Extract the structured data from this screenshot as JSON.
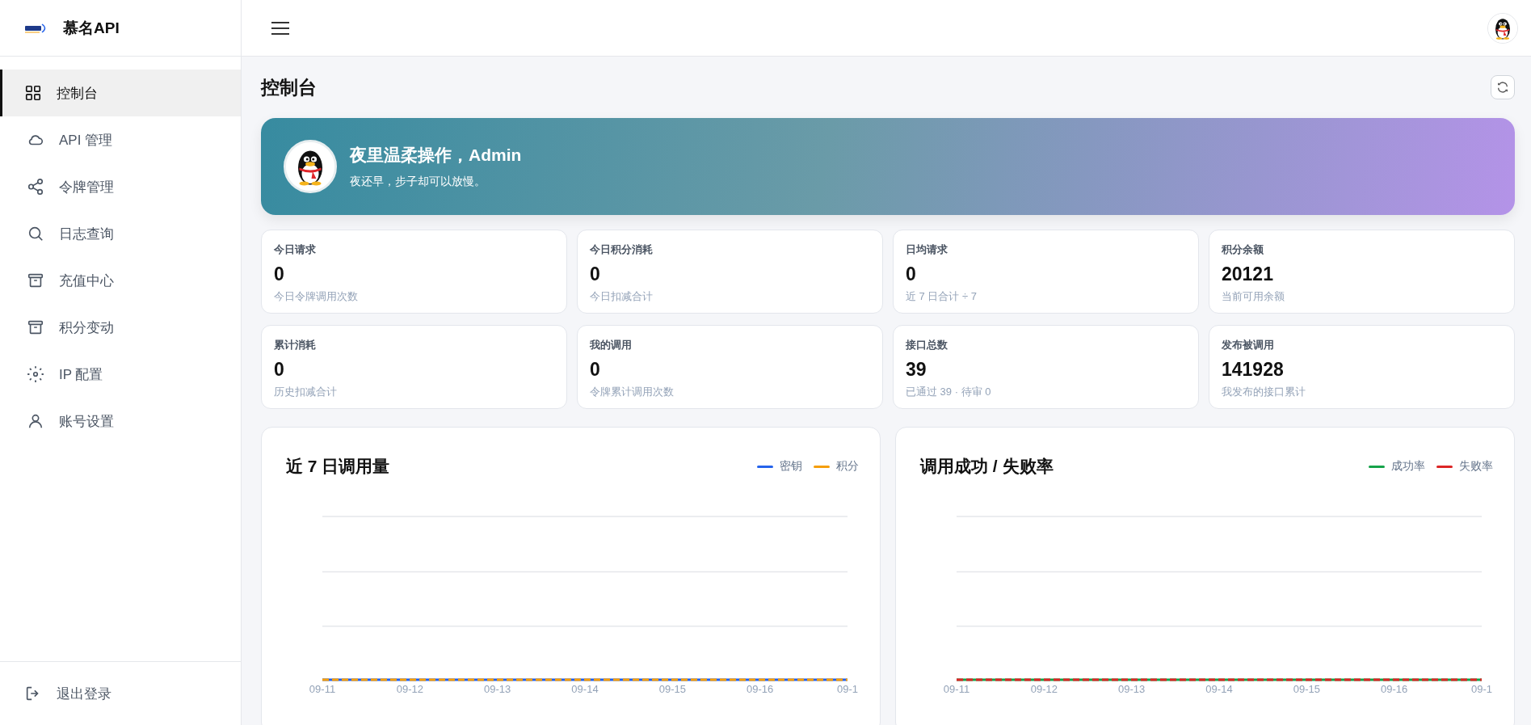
{
  "brand": {
    "name": "慕名API"
  },
  "sidebar": {
    "items": [
      {
        "label": "控制台",
        "selected": true
      },
      {
        "label": "API 管理",
        "selected": false
      },
      {
        "label": "令牌管理",
        "selected": false
      },
      {
        "label": "日志查询",
        "selected": false
      },
      {
        "label": "充值中心",
        "selected": false
      },
      {
        "label": "积分变动",
        "selected": false
      },
      {
        "label": "IP 配置",
        "selected": false
      },
      {
        "label": "账号设置",
        "selected": false
      }
    ],
    "logout": "退出登录"
  },
  "page": {
    "title": "控制台"
  },
  "banner": {
    "greeting": "夜里温柔操作，Admin",
    "subtitle": "夜还早，步子却可以放慢。"
  },
  "stats": [
    {
      "label": "今日请求",
      "value": "0",
      "note": "今日令牌调用次数"
    },
    {
      "label": "今日积分消耗",
      "value": "0",
      "note": "今日扣减合计"
    },
    {
      "label": "日均请求",
      "value": "0",
      "note": "近 7 日合计 ÷ 7"
    },
    {
      "label": "积分余额",
      "value": "20121",
      "note": "当前可用余额"
    },
    {
      "label": "累计消耗",
      "value": "0",
      "note": "历史扣减合计"
    },
    {
      "label": "我的调用",
      "value": "0",
      "note": "令牌累计调用次数"
    },
    {
      "label": "接口总数",
      "value": "39",
      "note": "已通过 39 · 待审 0"
    },
    {
      "label": "发布被调用",
      "value": "141928",
      "note": "我发布的接口累计"
    }
  ],
  "charts": [
    {
      "title": "近 7 日调用量",
      "legend": [
        {
          "label": "密钥",
          "color": "#2563eb"
        },
        {
          "label": "积分",
          "color": "#f59e0b"
        }
      ],
      "x_labels": [
        "09-11",
        "09-12",
        "09-13",
        "09-14",
        "09-15",
        "09-16",
        "09-1"
      ]
    },
    {
      "title": "调用成功 / 失败率",
      "legend": [
        {
          "label": "成功率",
          "color": "#16a34a"
        },
        {
          "label": "失败率",
          "color": "#dc2626"
        }
      ],
      "x_labels": [
        "09-11",
        "09-12",
        "09-13",
        "09-14",
        "09-15",
        "09-16",
        "09-1"
      ]
    }
  ]
}
